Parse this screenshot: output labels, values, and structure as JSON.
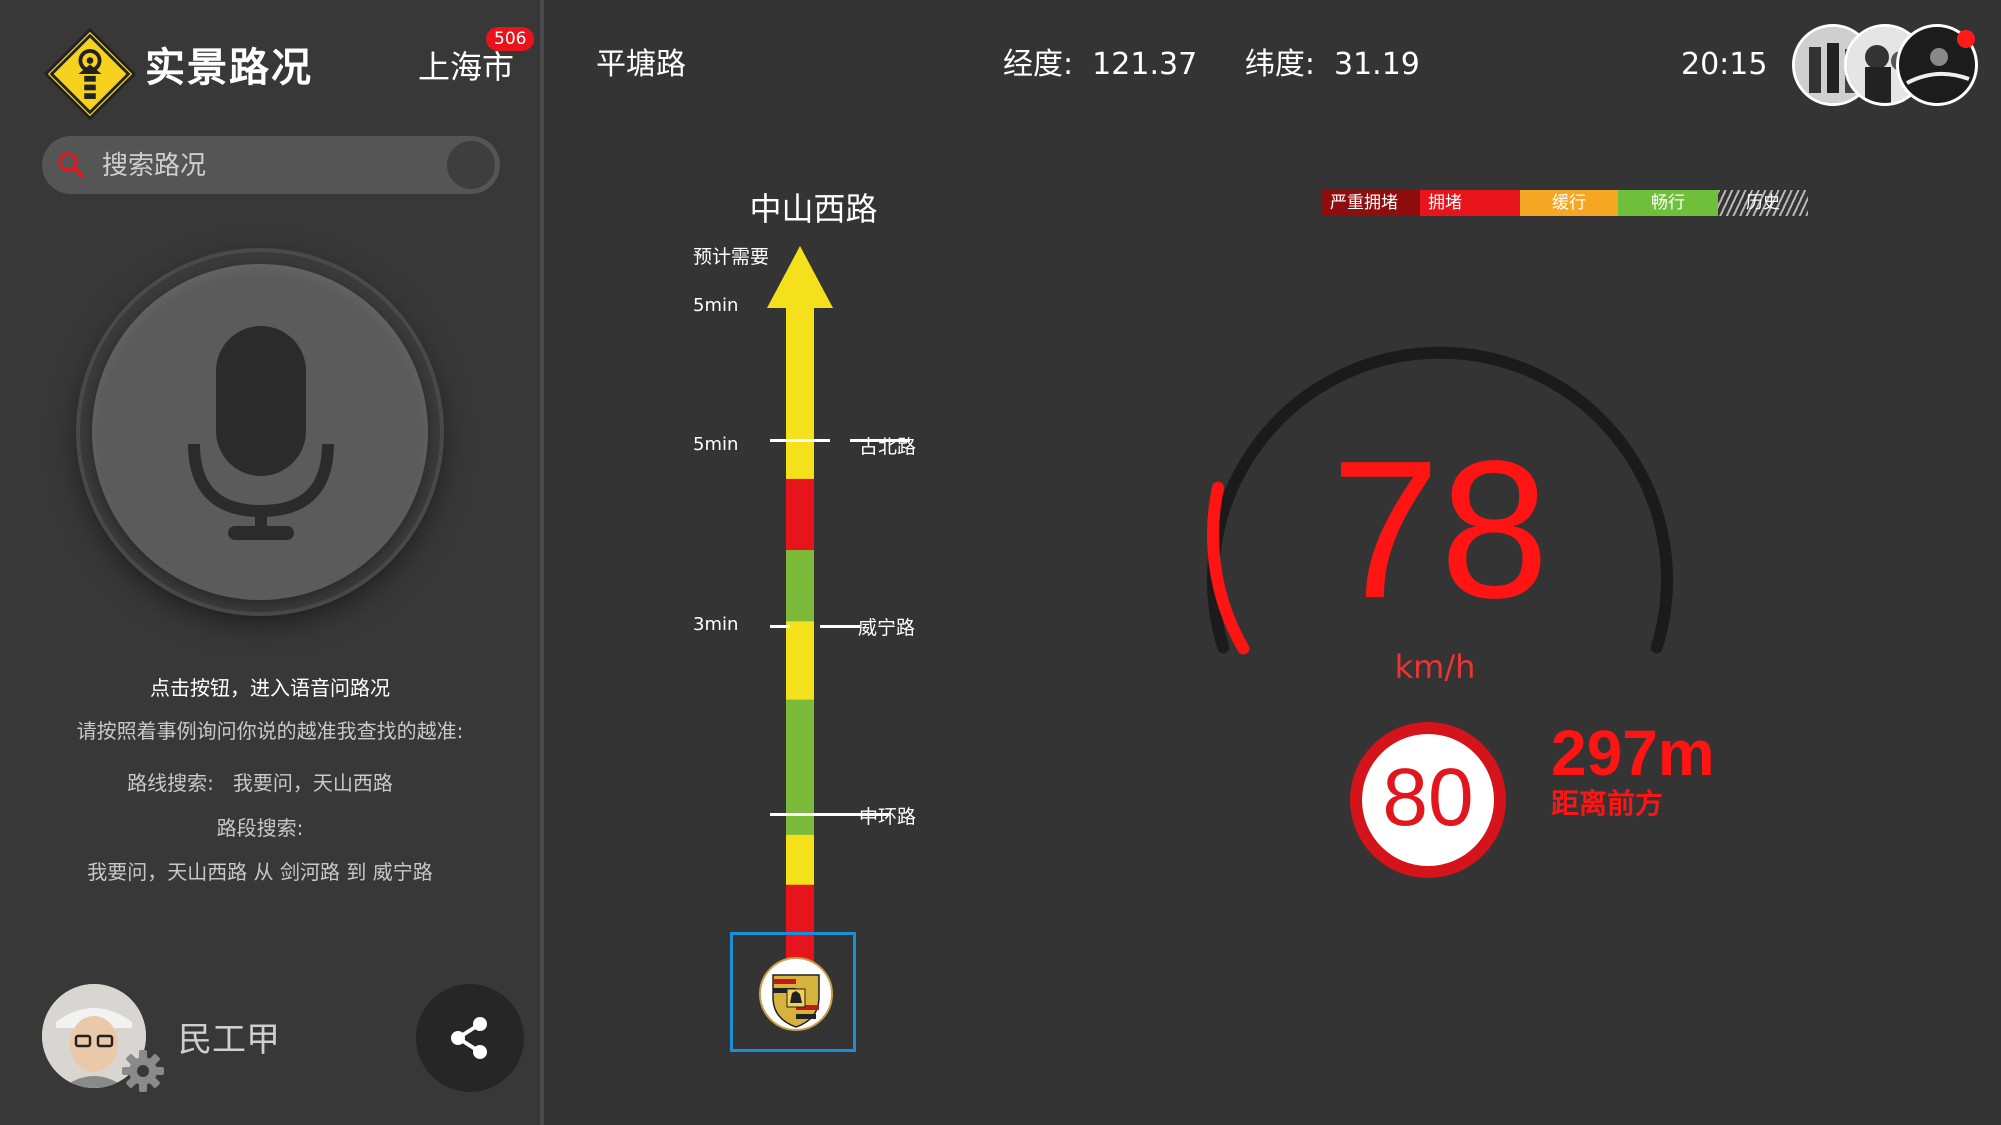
{
  "app": {
    "title": "实景路况",
    "city": "上海市",
    "city_badge": "506"
  },
  "search": {
    "placeholder": "搜索路况"
  },
  "voice": {
    "hint_title": "点击按钮，进入语音问路况",
    "hint_desc": "请按照着事例询问你说的越准我查找的越准:",
    "route_example": "路线搜索:   我要问，天山西路",
    "segment_label": "路段搜索:",
    "segment_example": "我要问，天山西路 从 剑河路 到 威宁路"
  },
  "user": {
    "name": "民工甲"
  },
  "topbar": {
    "current_road": "平塘路",
    "coords": "经度:  121.37     纬度:  31.19",
    "time": "20:15"
  },
  "route": {
    "target_road": "中山西路",
    "eta_label": "预计需要",
    "times": [
      "5min",
      "5min",
      "3min"
    ],
    "roads": [
      "古北路",
      "威宁路",
      "中环路"
    ],
    "segments": [
      {
        "status": "缓行",
        "share": 0.24
      },
      {
        "status": "拥堵",
        "share": 0.1
      },
      {
        "status": "畅行",
        "share": 0.1
      },
      {
        "status": "缓行",
        "share": 0.11
      },
      {
        "status": "畅行",
        "share": 0.19
      },
      {
        "status": "缓行",
        "share": 0.07
      },
      {
        "status": "拥堵",
        "share": 0.19
      }
    ]
  },
  "legend": [
    "严重拥堵",
    "拥堵",
    "缓行",
    "畅行",
    "历史"
  ],
  "colors": {
    "severe": "#8e0d0d",
    "jam": "#e8141c",
    "slow": "#f5a623",
    "smooth": "#6fbf3a",
    "route_slow": "#f5e11b",
    "route_smooth": "#7cbb3a",
    "speed": "#ff1414"
  },
  "speed": {
    "value": "78",
    "unit": "km/h",
    "gauge_fill": 0.14
  },
  "limit": {
    "value": "80",
    "distance": "297m",
    "distance_label": "距离前方"
  },
  "icons": [
    "logo-icon",
    "search-icon",
    "microphone-icon",
    "settings-gear-icon",
    "share-icon",
    "porsche-logo-icon"
  ]
}
